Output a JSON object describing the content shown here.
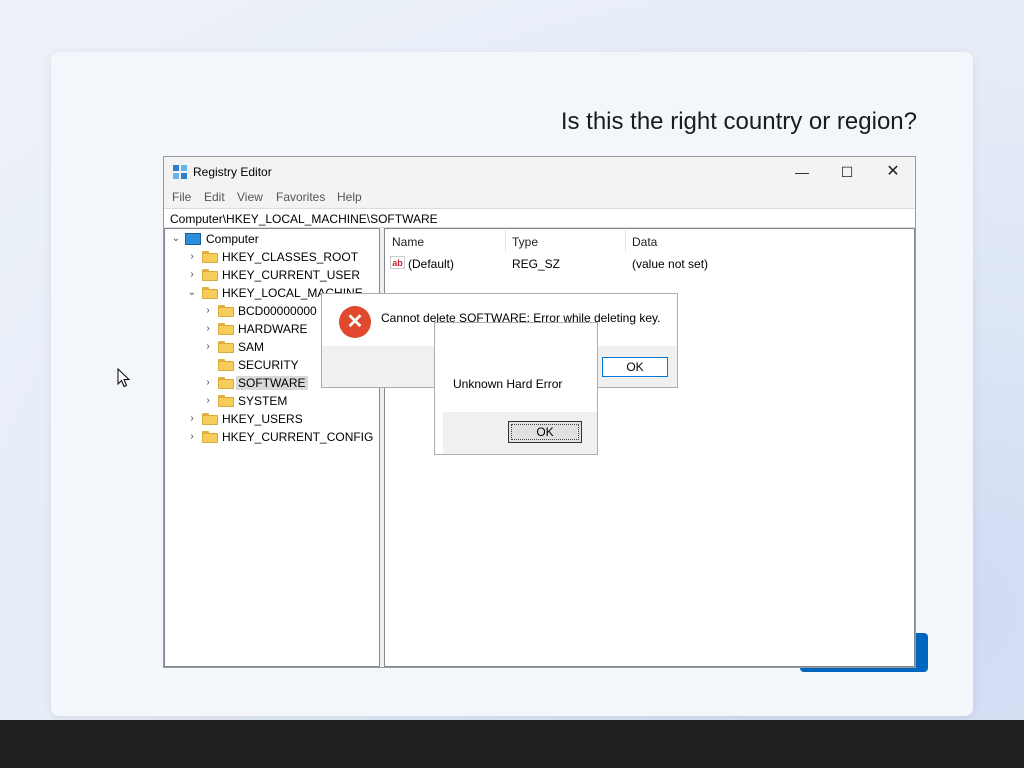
{
  "oobe": {
    "title": "Is this the right country or region?",
    "primary_color": "#0067c0"
  },
  "regedit": {
    "title": "Registry Editor",
    "window_buttons": {
      "minimize": "—",
      "maximize": "☐",
      "close": "✕"
    },
    "menu": [
      "File",
      "Edit",
      "View",
      "Favorites",
      "Help"
    ],
    "address": "Computer\\HKEY_LOCAL_MACHINE\\SOFTWARE",
    "tree": {
      "root": "Computer",
      "nodes": [
        "HKEY_CLASSES_ROOT",
        "HKEY_CURRENT_USER",
        "HKEY_LOCAL_MACHINE",
        "BCD00000000",
        "HARDWARE",
        "SAM",
        "SECURITY",
        "SOFTWARE",
        "SYSTEM",
        "HKEY_USERS",
        "HKEY_CURRENT_CONFIG"
      ],
      "selected": "SOFTWARE"
    },
    "columns": [
      "Name",
      "Type",
      "Data"
    ],
    "rows": [
      {
        "icon": "string-value-icon",
        "icon_text": "ab",
        "name": "(Default)",
        "type": "REG_SZ",
        "data": "(value not set)"
      }
    ]
  },
  "error_dialog": {
    "icon": "error-x-icon",
    "icon_glyph": "✕",
    "icon_color": "#e0492e",
    "message": "Cannot delete SOFTWARE:  Error while deleting key.",
    "ok_label": "OK"
  },
  "hard_error_dialog": {
    "message": "Unknown Hard Error",
    "ok_label": "OK"
  }
}
